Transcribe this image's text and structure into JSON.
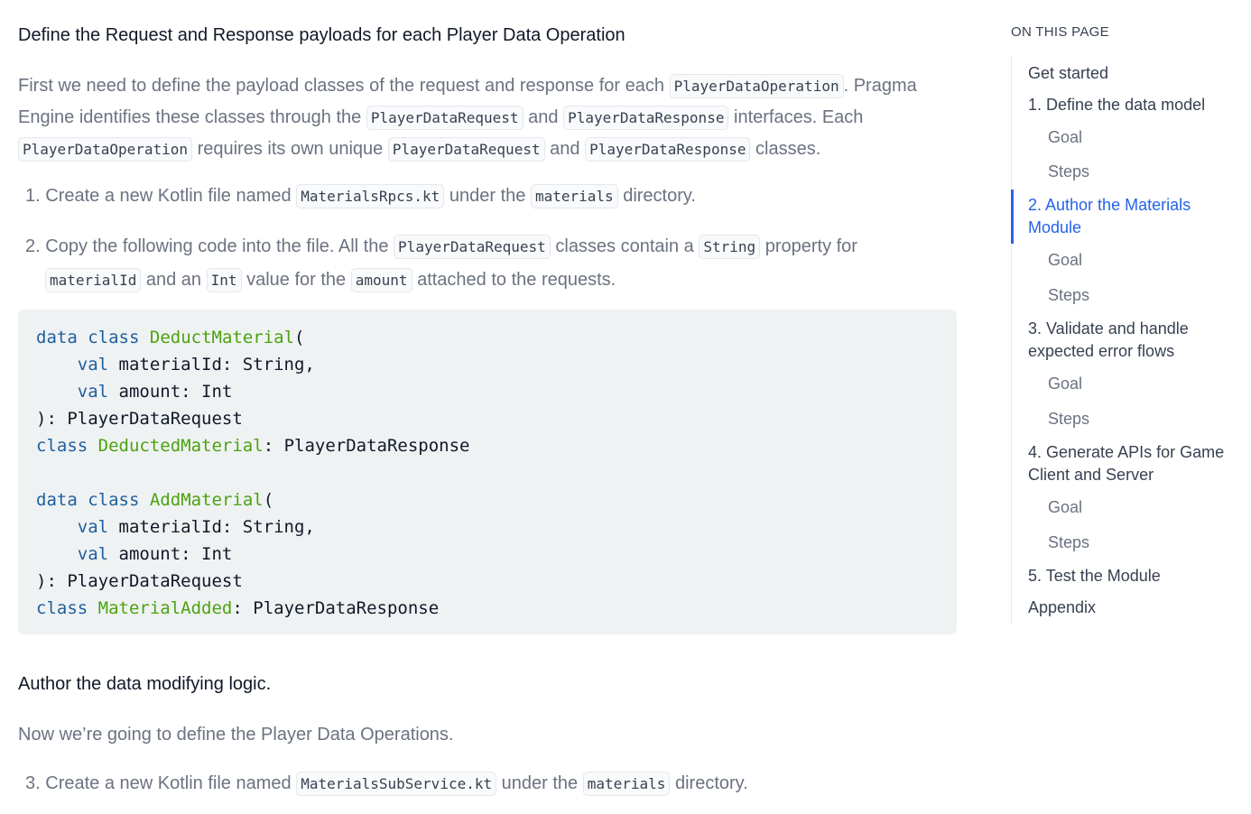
{
  "content": {
    "heading_payloads": "Define the Request and Response payloads for each Player Data Operation",
    "intro": {
      "t1": "First we need to define the payload classes of the request and response for each ",
      "c1": "PlayerDataOperation",
      "t2": ". Pragma Engine identifies these classes through the ",
      "c2": "PlayerDataRequest",
      "t3": " and ",
      "c3": "PlayerDataResponse",
      "t4": " interfaces. Each ",
      "c4": "PlayerDataOperation",
      "t5": " requires its own unique ",
      "c5": "PlayerDataRequest",
      "t6": " and ",
      "c6": "PlayerDataResponse",
      "t7": " classes."
    },
    "step1": {
      "num": "1.",
      "t1": "Create a new Kotlin file named ",
      "c1": "MaterialsRpcs.kt",
      "t2": " under the ",
      "c2": "materials",
      "t3": " directory."
    },
    "step2": {
      "num": "2.",
      "t1": "Copy the following code into the file. All the ",
      "c1": "PlayerDataRequest",
      "t2": " classes contain a ",
      "c2": "String",
      "t3": " property for",
      "c3": "materialId",
      "t4": " and an ",
      "c4": "Int",
      "t5": " value for the ",
      "c5": "amount",
      "t6": " attached to the requests."
    },
    "code": {
      "l1_kw1": "data",
      "l1_kw2": "class",
      "l1_cls": "DeductMaterial",
      "l1_rest": "(",
      "l2_kw": "val",
      "l2_rest": " materialId: String,",
      "l3_kw": "val",
      "l3_rest": " amount: Int",
      "l4": "): PlayerDataRequest",
      "l5_kw": "class",
      "l5_cls": "DeductedMaterial",
      "l5_rest": ": PlayerDataResponse",
      "l7_kw1": "data",
      "l7_kw2": "class",
      "l7_cls": "AddMaterial",
      "l7_rest": "(",
      "l8_kw": "val",
      "l8_rest": " materialId: String,",
      "l9_kw": "val",
      "l9_rest": " amount: Int",
      "l10": "): PlayerDataRequest",
      "l11_kw": "class",
      "l11_cls": "MaterialAdded",
      "l11_rest": ": PlayerDataResponse"
    },
    "heading_logic": "Author the data modifying logic.",
    "logic_intro": "Now we’re going to define the Player Data Operations.",
    "step3": {
      "num": "3.",
      "t1": "Create a new Kotlin file named ",
      "c1": "MaterialsSubService.kt",
      "t2": " under the ",
      "c2": "materials",
      "t3": " directory."
    }
  },
  "toc": {
    "title": "ON THIS PAGE",
    "items": [
      {
        "label": "Get started"
      },
      {
        "label": "1. Define the data model"
      },
      {
        "label": "Goal"
      },
      {
        "label": "Steps"
      },
      {
        "label": "2. Author the Materials Module"
      },
      {
        "label": "Goal"
      },
      {
        "label": "Steps"
      },
      {
        "label": "3. Validate and handle expected error flows"
      },
      {
        "label": "Goal"
      },
      {
        "label": "Steps"
      },
      {
        "label": "4. Generate APIs for Game Client and Server"
      },
      {
        "label": "Goal"
      },
      {
        "label": "Steps"
      },
      {
        "label": "5. Test the Module"
      },
      {
        "label": "Appendix"
      }
    ]
  },
  "colors": {
    "accent": "#2563eb",
    "code_keyword": "#1f5f9e",
    "code_class": "#4ca20f",
    "code_bg": "#eff2f3"
  }
}
